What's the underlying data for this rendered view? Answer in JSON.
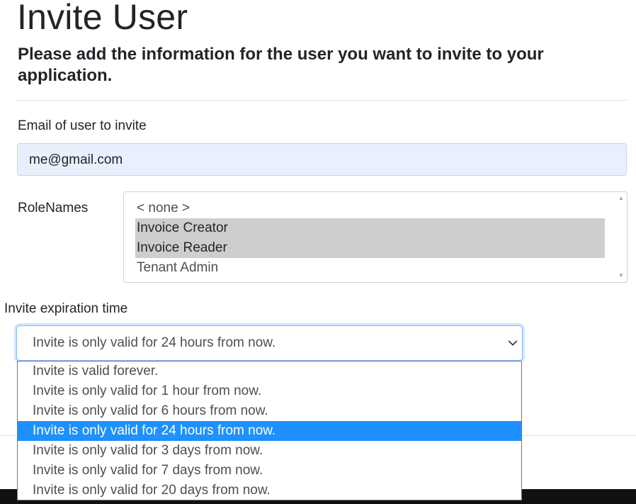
{
  "header": {
    "title": "Invite User",
    "subtitle": "Please add the information for the user you want to invite to your application."
  },
  "email": {
    "label": "Email of user to invite",
    "value": "me@gmail.com"
  },
  "roles": {
    "label": "RoleNames",
    "options": [
      {
        "label": "< none >",
        "selected": false
      },
      {
        "label": "Invoice Creator",
        "selected": true
      },
      {
        "label": "Invoice Reader",
        "selected": true
      },
      {
        "label": "Tenant Admin",
        "selected": false
      }
    ]
  },
  "expiration": {
    "label": "Invite expiration time",
    "selected_value": "Invite is only valid for 24 hours from now.",
    "options": [
      {
        "label": "Invite is valid forever.",
        "highlighted": false
      },
      {
        "label": "Invite is only valid for 1 hour from now.",
        "highlighted": false
      },
      {
        "label": "Invite is only valid for 6 hours from now.",
        "highlighted": false
      },
      {
        "label": "Invite is only valid for 24 hours from now.",
        "highlighted": true
      },
      {
        "label": "Invite is only valid for 3 days from now.",
        "highlighted": false
      },
      {
        "label": "Invite is only valid for 7 days from now.",
        "highlighted": false
      },
      {
        "label": "Invite is only valid for 20 days from now.",
        "highlighted": false
      }
    ]
  },
  "icons": {
    "select_chevron": "chevron-down-icon",
    "scroll_up": "scroll-up-arrow-icon",
    "scroll_down": "scroll-down-arrow-icon"
  },
  "colors": {
    "highlight": "#1e90ff",
    "role_selected": "#cecece",
    "email_autofill": "#e8f0fe",
    "focus_border": "#86b7fe"
  }
}
